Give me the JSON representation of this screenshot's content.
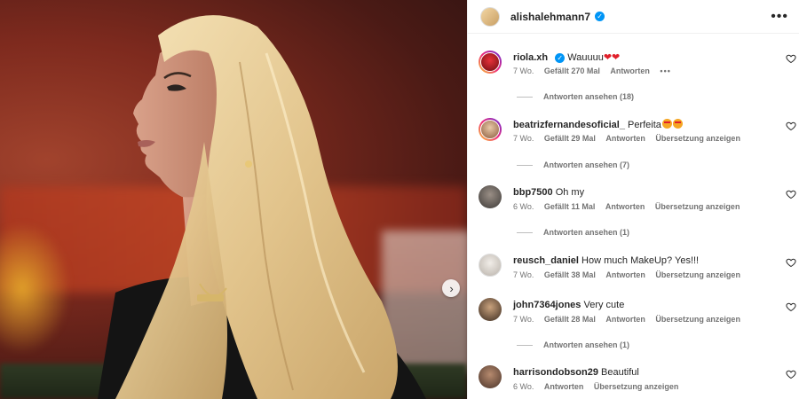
{
  "post": {
    "author": "alishalehmann7",
    "verified": true
  },
  "comments": [
    {
      "user": "riola.xh",
      "verified": true,
      "text": "Wauuuu",
      "emoji": [
        "heart",
        "heart"
      ],
      "age": "7 Wo.",
      "likes": "Gefällt 270 Mal",
      "reply": "Antworten",
      "translate": "",
      "more": "•••",
      "replies": "Antworten ansehen (18)"
    },
    {
      "user": "beatrizfernandesoficial_",
      "verified": false,
      "text": "Perfeita",
      "emoji": [
        "face",
        "face"
      ],
      "age": "7 Wo.",
      "likes": "Gefällt 29 Mal",
      "reply": "Antworten",
      "translate": "Übersetzung anzeigen",
      "replies": "Antworten ansehen (7)"
    },
    {
      "user": "bbp7500",
      "verified": false,
      "text": "Oh my",
      "age": "6 Wo.",
      "likes": "Gefällt 11 Mal",
      "reply": "Antworten",
      "translate": "Übersetzung anzeigen",
      "replies": "Antworten ansehen (1)"
    },
    {
      "user": "reusch_daniel",
      "verified": false,
      "text": "How much MakeUp? Yes!!!",
      "age": "7 Wo.",
      "likes": "Gefällt 38 Mal",
      "reply": "Antworten",
      "translate": "Übersetzung anzeigen",
      "replies": ""
    },
    {
      "user": "john7364jones",
      "verified": false,
      "text": "Very cute",
      "age": "7 Wo.",
      "likes": "Gefällt 28 Mal",
      "reply": "Antworten",
      "translate": "Übersetzung anzeigen",
      "replies": "Antworten ansehen (1)"
    },
    {
      "user": "harrisondobson29",
      "verified": false,
      "text": "Beautiful",
      "age": "6 Wo.",
      "likes": "",
      "reply": "Antworten",
      "translate": "Übersetzung anzeigen",
      "replies": ""
    }
  ],
  "icons": {
    "next": "chevron-right-icon",
    "more": "more-horizontal-icon",
    "like": "heart-outline-icon"
  },
  "colors": {
    "verified": "#0095f6",
    "meta": "#737373",
    "text": "#262626"
  }
}
